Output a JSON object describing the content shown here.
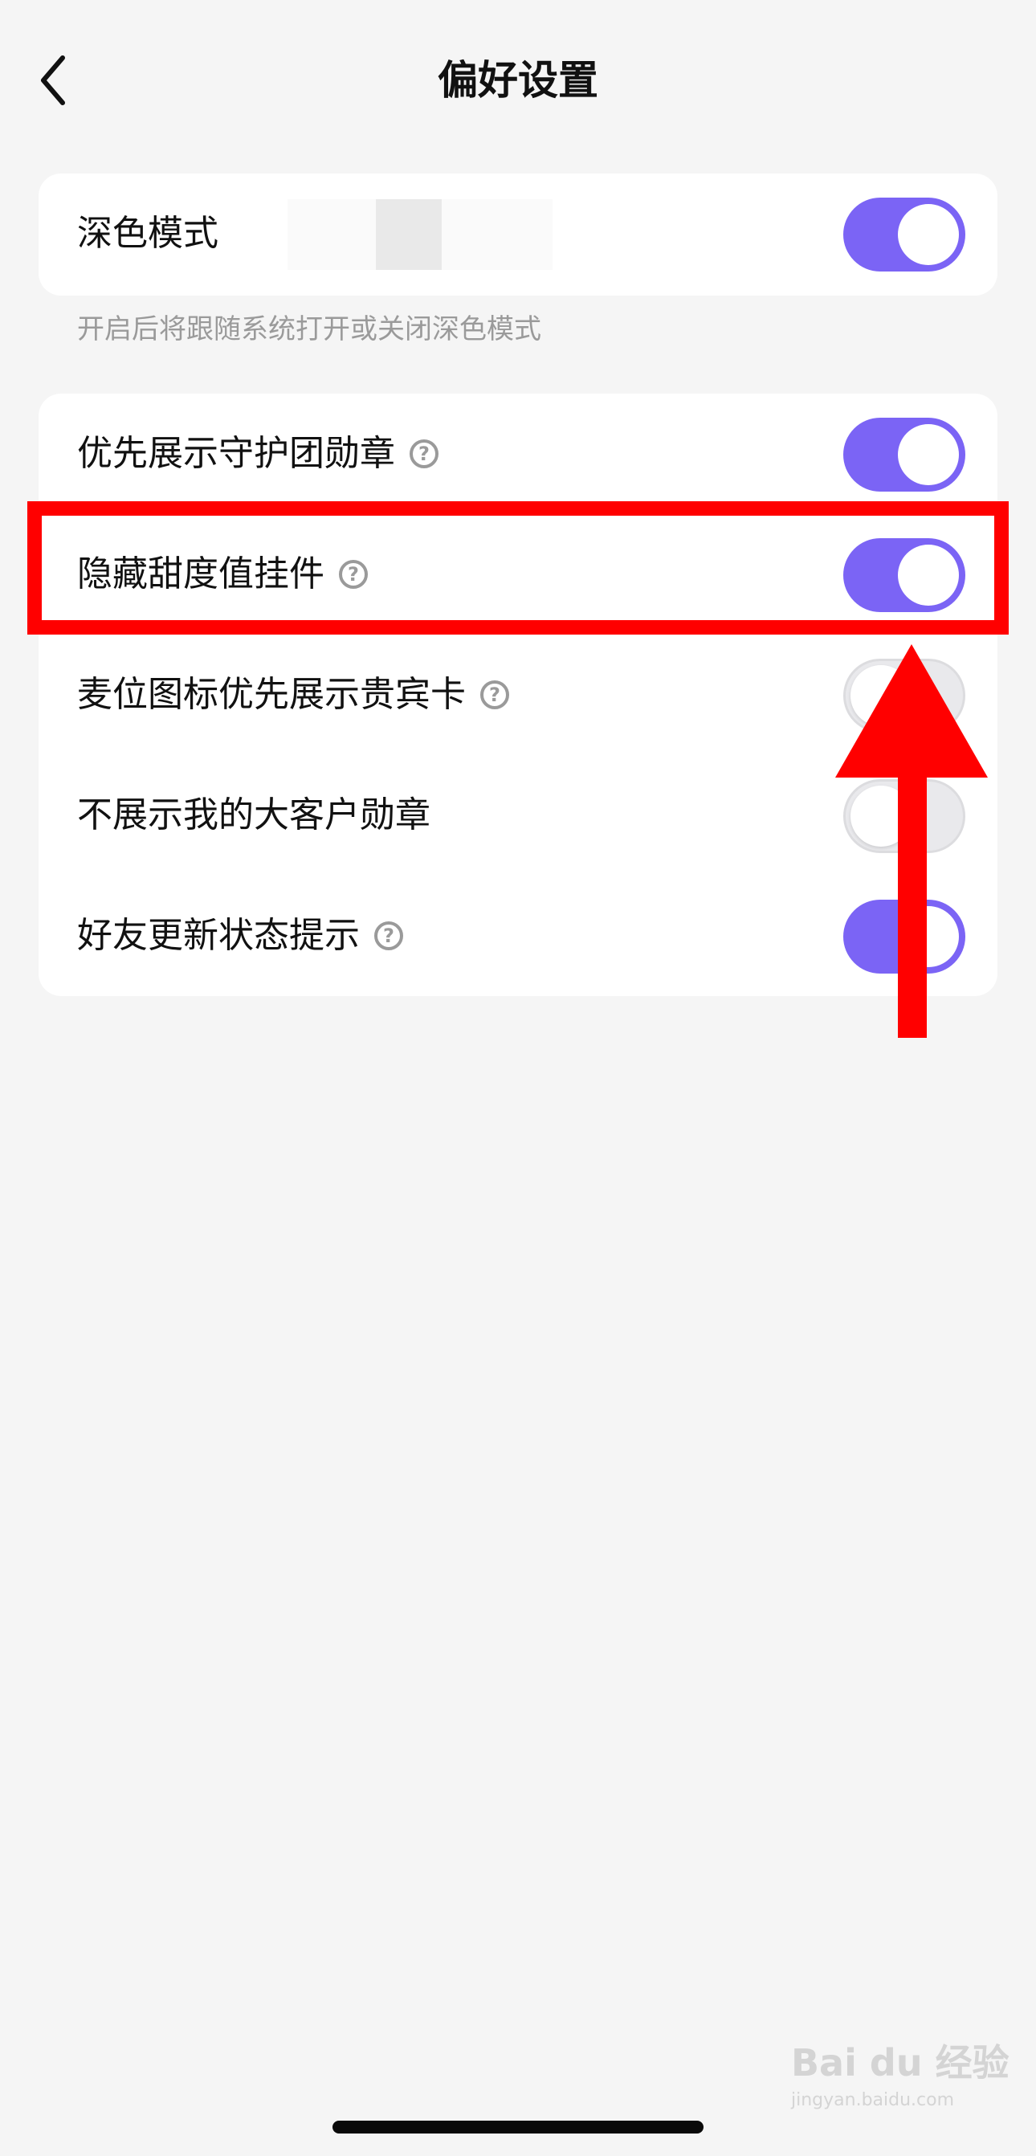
{
  "header": {
    "title": "偏好设置",
    "back_icon": "chevron-left-icon"
  },
  "dark_mode": {
    "label": "深色模式",
    "enabled": true,
    "note": "开启后将跟随系统打开或关闭深色模式"
  },
  "settings": [
    {
      "label": "优先展示守护团勋章",
      "help": "?",
      "enabled": true
    },
    {
      "label": "隐藏甜度值挂件",
      "help": "?",
      "enabled": true
    },
    {
      "label": "麦位图标优先展示贵宾卡",
      "help": "?",
      "enabled": false
    },
    {
      "label": "不展示我的大客户勋章",
      "help": "",
      "enabled": false
    },
    {
      "label": "好友更新状态提示",
      "help": "?",
      "enabled": true
    }
  ],
  "colors": {
    "toggle_on": "#7b64f5",
    "toggle_off": "#e9e9ec",
    "annotation": "#ff0000",
    "background": "#f5f5f5"
  },
  "watermark": {
    "text": "Bai du 经验",
    "sub": "jingyan.baidu.com"
  }
}
